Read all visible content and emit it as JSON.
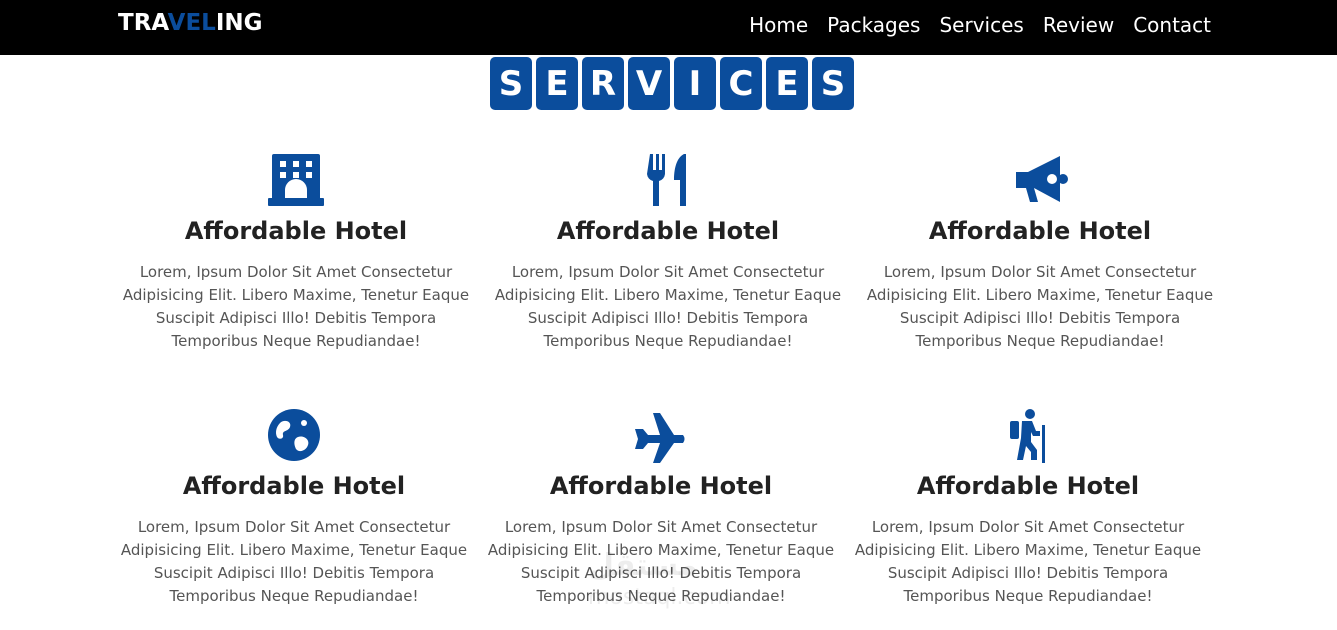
{
  "nav": {
    "logo_part1": "TRA",
    "logo_part2": "VEL",
    "logo_part3": "ING",
    "links": [
      "Home",
      "Packages",
      "Services",
      "Review",
      "Contact"
    ]
  },
  "heading": {
    "letters": [
      "S",
      "E",
      "R",
      "V",
      "I",
      "C",
      "E",
      "S"
    ]
  },
  "colors": {
    "accent": "#0b4d9c",
    "navbar": "#000000"
  },
  "services": [
    {
      "icon": "hotel-icon",
      "title": "Affordable Hotel",
      "desc": "Lorem, Ipsum Dolor Sit Amet Consectetur Adipisicing Elit. Libero Maxime, Tenetur Eaque Suscipit Adipisci Illo! Debitis Tempora Temporibus Neque Repudiandae!"
    },
    {
      "icon": "utensils-icon",
      "title": "Affordable Hotel",
      "desc": "Lorem, Ipsum Dolor Sit Amet Consectetur Adipisicing Elit. Libero Maxime, Tenetur Eaque Suscipit Adipisci Illo! Debitis Tempora Temporibus Neque Repudiandae!"
    },
    {
      "icon": "megaphone-icon",
      "title": "Affordable Hotel",
      "desc": "Lorem, Ipsum Dolor Sit Amet Consectetur Adipisicing Elit. Libero Maxime, Tenetur Eaque Suscipit Adipisci Illo! Debitis Tempora Temporibus Neque Repudiandae!"
    },
    {
      "icon": "globe-icon",
      "title": "Affordable Hotel",
      "desc": "Lorem, Ipsum Dolor Sit Amet Consectetur Adipisicing Elit. Libero Maxime, Tenetur Eaque Suscipit Adipisci Illo! Debitis Tempora Temporibus Neque Repudiandae!"
    },
    {
      "icon": "plane-icon",
      "title": "Affordable Hotel",
      "desc": "Lorem, Ipsum Dolor Sit Amet Consectetur Adipisicing Elit. Libero Maxime, Tenetur Eaque Suscipit Adipisci Illo! Debitis Tempora Temporibus Neque Repudiandae!"
    },
    {
      "icon": "hiking-icon",
      "title": "Affordable Hotel",
      "desc": "Lorem, Ipsum Dolor Sit Amet Consectetur Adipisicing Elit. Libero Maxime, Tenetur Eaque Suscipit Adipisci Illo! Debitis Tempora Temporibus Neque Repudiandae!"
    }
  ],
  "watermark": {
    "arabic": "مستقل",
    "latin": "mostaql.com"
  }
}
